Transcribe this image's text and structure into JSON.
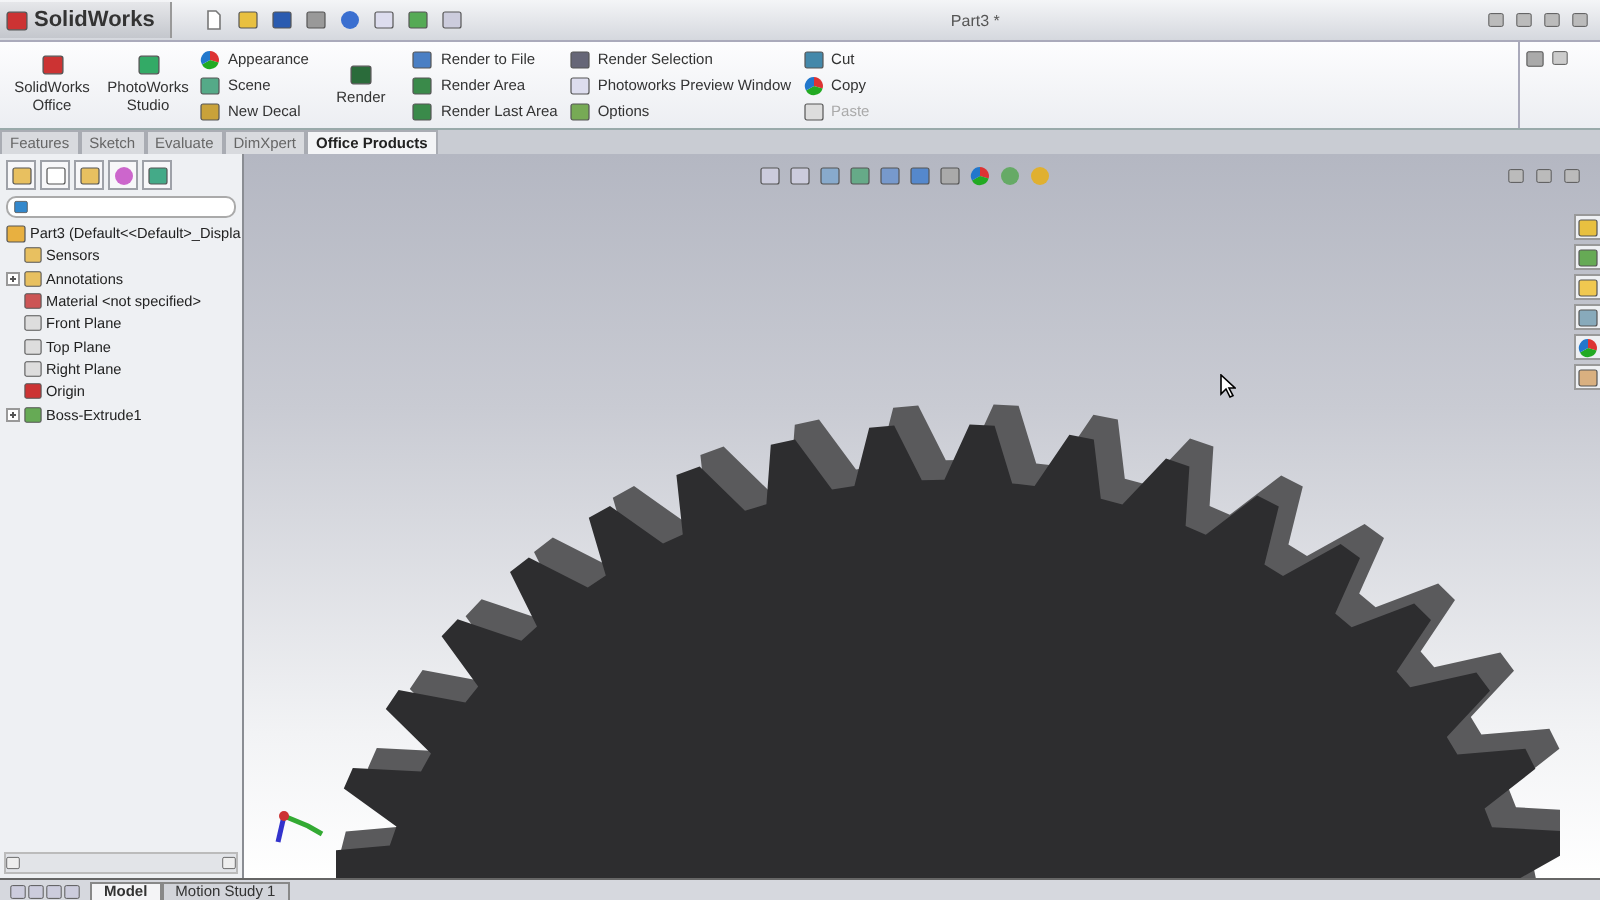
{
  "title_bar": {
    "app_name": "SolidWorks",
    "document": "Part3 *"
  },
  "ribbon": {
    "groups": [
      {
        "kind": "large",
        "items": [
          {
            "label": "SolidWorks Office",
            "disabled": false
          }
        ]
      },
      {
        "kind": "large",
        "items": [
          {
            "label": "PhotoWorks Studio",
            "disabled": false
          }
        ]
      },
      {
        "kind": "column",
        "items": [
          {
            "label": "Appearance",
            "disabled": false
          },
          {
            "label": "Scene",
            "disabled": false
          },
          {
            "label": "New Decal",
            "disabled": false
          }
        ]
      },
      {
        "kind": "large",
        "items": [
          {
            "label": "Render",
            "disabled": false
          }
        ]
      },
      {
        "kind": "column",
        "items": [
          {
            "label": "Render to File",
            "disabled": false
          },
          {
            "label": "Render Area",
            "disabled": false
          },
          {
            "label": "Render Last Area",
            "disabled": false
          }
        ]
      },
      {
        "kind": "column",
        "items": [
          {
            "label": "Render Selection",
            "disabled": false
          },
          {
            "label": "Photoworks Preview Window",
            "disabled": false
          },
          {
            "label": "Options",
            "disabled": false
          }
        ]
      },
      {
        "kind": "column",
        "items": [
          {
            "label": "Cut",
            "disabled": false
          },
          {
            "label": "Copy",
            "disabled": false
          },
          {
            "label": "Paste",
            "disabled": true
          }
        ]
      }
    ]
  },
  "command_tabs": [
    {
      "label": "Features",
      "selected": false
    },
    {
      "label": "Sketch",
      "selected": false
    },
    {
      "label": "Evaluate",
      "selected": false
    },
    {
      "label": "DimXpert",
      "selected": false
    },
    {
      "label": "Office Products",
      "selected": true
    }
  ],
  "feature_tree": {
    "root": "Part3  (Default<<Default>_Displa",
    "items": [
      {
        "label": "Sensors",
        "expandable": false
      },
      {
        "label": "Annotations",
        "expandable": true
      },
      {
        "label": "Material <not specified>",
        "expandable": false
      },
      {
        "label": "Front Plane",
        "expandable": false
      },
      {
        "label": "Top Plane",
        "expandable": false
      },
      {
        "label": "Right Plane",
        "expandable": false
      },
      {
        "label": "Origin",
        "expandable": false
      },
      {
        "label": "Boss-Extrude1",
        "expandable": true
      }
    ]
  },
  "bottom_tabs": [
    {
      "label": "Model",
      "selected": true
    },
    {
      "label": "Motion Study 1",
      "selected": false
    }
  ]
}
